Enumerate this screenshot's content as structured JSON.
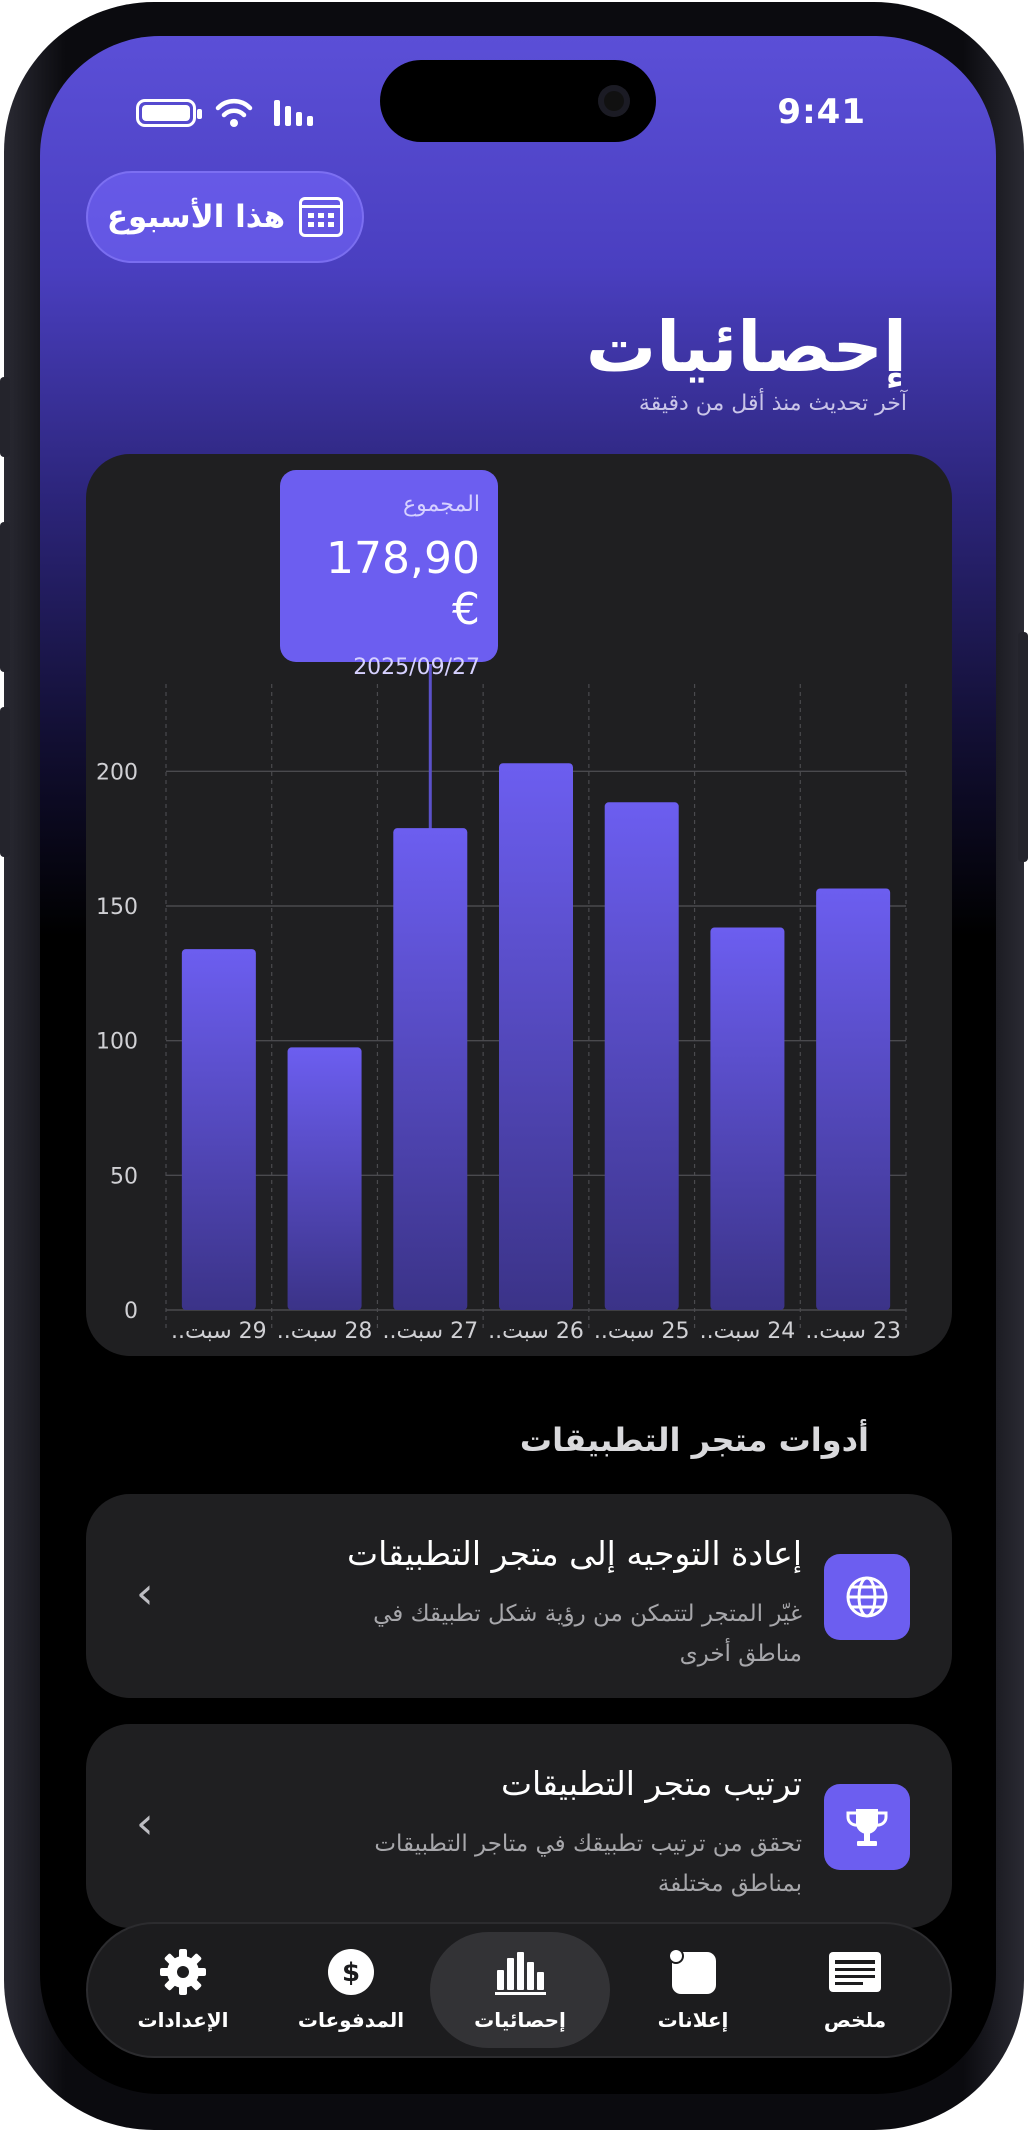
{
  "status": {
    "time": "9:41"
  },
  "header": {
    "week_button": "هذا الأسبوع",
    "title": "إحصائيات",
    "subtitle": "آخر تحديث منذ أقل من دقيقة"
  },
  "tooltip": {
    "label": "المجموع",
    "value": "178,90 €",
    "date": "2025/09/27"
  },
  "chart_data": {
    "type": "bar",
    "categories": [
      "23 سبت..",
      "24 سبت..",
      "25 سبت..",
      "26 سبت..",
      "27 سبت..",
      "28 سبت..",
      "29 سبت.."
    ],
    "values": [
      156.5,
      142,
      188.5,
      203,
      178.9,
      97.5,
      134
    ],
    "ylim": [
      0,
      225
    ],
    "yticks": [
      0,
      50,
      100,
      150,
      200
    ],
    "selected_category": "27 سبت..",
    "direction": "rtl",
    "grid": true,
    "colors": {
      "bar_top": "#6c5ef0",
      "bar_bottom": "#3b3388"
    }
  },
  "section_title": "أدوات متجر التطبيقات",
  "tools": [
    {
      "title": "إعادة التوجيه إلى متجر التطبيقات",
      "desc": "غيّر المتجر لتتمكن من رؤية شكل تطبيقك في مناطق أخرى",
      "icon": "globe-icon"
    },
    {
      "title": "ترتيب متجر التطبيقات",
      "desc": "تحقق من ترتيب تطبيقك في متاجر التطبيقات بمناطق مختلفة",
      "icon": "trophy-icon"
    }
  ],
  "tabs": [
    {
      "label": "ملخص",
      "icon": "summary-icon"
    },
    {
      "label": "إعلانات",
      "icon": "ads-icon"
    },
    {
      "label": "إحصائيات",
      "icon": "stats-icon",
      "active": true
    },
    {
      "label": "المدفوعات",
      "icon": "dollar-icon"
    },
    {
      "label": "الإعدادات",
      "icon": "gear-icon"
    }
  ],
  "colors": {
    "accent": "#6c5ef0",
    "card": "#1f1f21"
  }
}
